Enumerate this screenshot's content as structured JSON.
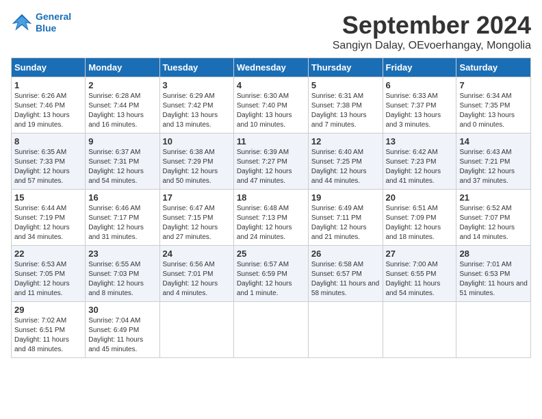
{
  "logo": {
    "line1": "General",
    "line2": "Blue"
  },
  "title": "September 2024",
  "subtitle": "Sangiyn Dalay, OEvoerhangay, Mongolia",
  "headers": [
    "Sunday",
    "Monday",
    "Tuesday",
    "Wednesday",
    "Thursday",
    "Friday",
    "Saturday"
  ],
  "weeks": [
    [
      {
        "day": "1",
        "sunrise": "Sunrise: 6:26 AM",
        "sunset": "Sunset: 7:46 PM",
        "daylight": "Daylight: 13 hours and 19 minutes."
      },
      {
        "day": "2",
        "sunrise": "Sunrise: 6:28 AM",
        "sunset": "Sunset: 7:44 PM",
        "daylight": "Daylight: 13 hours and 16 minutes."
      },
      {
        "day": "3",
        "sunrise": "Sunrise: 6:29 AM",
        "sunset": "Sunset: 7:42 PM",
        "daylight": "Daylight: 13 hours and 13 minutes."
      },
      {
        "day": "4",
        "sunrise": "Sunrise: 6:30 AM",
        "sunset": "Sunset: 7:40 PM",
        "daylight": "Daylight: 13 hours and 10 minutes."
      },
      {
        "day": "5",
        "sunrise": "Sunrise: 6:31 AM",
        "sunset": "Sunset: 7:38 PM",
        "daylight": "Daylight: 13 hours and 7 minutes."
      },
      {
        "day": "6",
        "sunrise": "Sunrise: 6:33 AM",
        "sunset": "Sunset: 7:37 PM",
        "daylight": "Daylight: 13 hours and 3 minutes."
      },
      {
        "day": "7",
        "sunrise": "Sunrise: 6:34 AM",
        "sunset": "Sunset: 7:35 PM",
        "daylight": "Daylight: 13 hours and 0 minutes."
      }
    ],
    [
      {
        "day": "8",
        "sunrise": "Sunrise: 6:35 AM",
        "sunset": "Sunset: 7:33 PM",
        "daylight": "Daylight: 12 hours and 57 minutes."
      },
      {
        "day": "9",
        "sunrise": "Sunrise: 6:37 AM",
        "sunset": "Sunset: 7:31 PM",
        "daylight": "Daylight: 12 hours and 54 minutes."
      },
      {
        "day": "10",
        "sunrise": "Sunrise: 6:38 AM",
        "sunset": "Sunset: 7:29 PM",
        "daylight": "Daylight: 12 hours and 50 minutes."
      },
      {
        "day": "11",
        "sunrise": "Sunrise: 6:39 AM",
        "sunset": "Sunset: 7:27 PM",
        "daylight": "Daylight: 12 hours and 47 minutes."
      },
      {
        "day": "12",
        "sunrise": "Sunrise: 6:40 AM",
        "sunset": "Sunset: 7:25 PM",
        "daylight": "Daylight: 12 hours and 44 minutes."
      },
      {
        "day": "13",
        "sunrise": "Sunrise: 6:42 AM",
        "sunset": "Sunset: 7:23 PM",
        "daylight": "Daylight: 12 hours and 41 minutes."
      },
      {
        "day": "14",
        "sunrise": "Sunrise: 6:43 AM",
        "sunset": "Sunset: 7:21 PM",
        "daylight": "Daylight: 12 hours and 37 minutes."
      }
    ],
    [
      {
        "day": "15",
        "sunrise": "Sunrise: 6:44 AM",
        "sunset": "Sunset: 7:19 PM",
        "daylight": "Daylight: 12 hours and 34 minutes."
      },
      {
        "day": "16",
        "sunrise": "Sunrise: 6:46 AM",
        "sunset": "Sunset: 7:17 PM",
        "daylight": "Daylight: 12 hours and 31 minutes."
      },
      {
        "day": "17",
        "sunrise": "Sunrise: 6:47 AM",
        "sunset": "Sunset: 7:15 PM",
        "daylight": "Daylight: 12 hours and 27 minutes."
      },
      {
        "day": "18",
        "sunrise": "Sunrise: 6:48 AM",
        "sunset": "Sunset: 7:13 PM",
        "daylight": "Daylight: 12 hours and 24 minutes."
      },
      {
        "day": "19",
        "sunrise": "Sunrise: 6:49 AM",
        "sunset": "Sunset: 7:11 PM",
        "daylight": "Daylight: 12 hours and 21 minutes."
      },
      {
        "day": "20",
        "sunrise": "Sunrise: 6:51 AM",
        "sunset": "Sunset: 7:09 PM",
        "daylight": "Daylight: 12 hours and 18 minutes."
      },
      {
        "day": "21",
        "sunrise": "Sunrise: 6:52 AM",
        "sunset": "Sunset: 7:07 PM",
        "daylight": "Daylight: 12 hours and 14 minutes."
      }
    ],
    [
      {
        "day": "22",
        "sunrise": "Sunrise: 6:53 AM",
        "sunset": "Sunset: 7:05 PM",
        "daylight": "Daylight: 12 hours and 11 minutes."
      },
      {
        "day": "23",
        "sunrise": "Sunrise: 6:55 AM",
        "sunset": "Sunset: 7:03 PM",
        "daylight": "Daylight: 12 hours and 8 minutes."
      },
      {
        "day": "24",
        "sunrise": "Sunrise: 6:56 AM",
        "sunset": "Sunset: 7:01 PM",
        "daylight": "Daylight: 12 hours and 4 minutes."
      },
      {
        "day": "25",
        "sunrise": "Sunrise: 6:57 AM",
        "sunset": "Sunset: 6:59 PM",
        "daylight": "Daylight: 12 hours and 1 minute."
      },
      {
        "day": "26",
        "sunrise": "Sunrise: 6:58 AM",
        "sunset": "Sunset: 6:57 PM",
        "daylight": "Daylight: 11 hours and 58 minutes."
      },
      {
        "day": "27",
        "sunrise": "Sunrise: 7:00 AM",
        "sunset": "Sunset: 6:55 PM",
        "daylight": "Daylight: 11 hours and 54 minutes."
      },
      {
        "day": "28",
        "sunrise": "Sunrise: 7:01 AM",
        "sunset": "Sunset: 6:53 PM",
        "daylight": "Daylight: 11 hours and 51 minutes."
      }
    ],
    [
      {
        "day": "29",
        "sunrise": "Sunrise: 7:02 AM",
        "sunset": "Sunset: 6:51 PM",
        "daylight": "Daylight: 11 hours and 48 minutes."
      },
      {
        "day": "30",
        "sunrise": "Sunrise: 7:04 AM",
        "sunset": "Sunset: 6:49 PM",
        "daylight": "Daylight: 11 hours and 45 minutes."
      },
      null,
      null,
      null,
      null,
      null
    ]
  ]
}
